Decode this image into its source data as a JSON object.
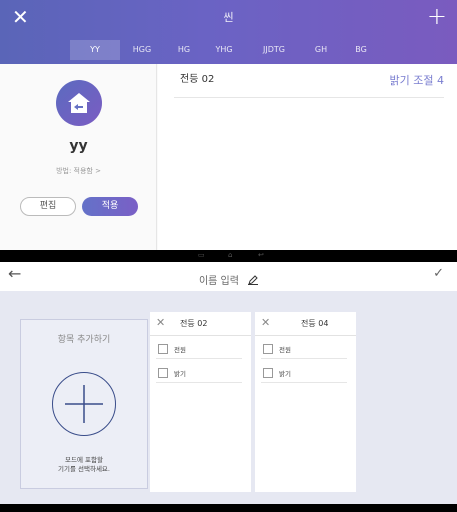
{
  "top": {
    "close_icon": "close-icon",
    "title": "씬",
    "add_icon": "plus-icon",
    "tabs": [
      "YY",
      "HGG",
      "HG",
      "YHG",
      "JJDTG",
      "GH",
      "BG"
    ],
    "mode": {
      "name": "yy",
      "sub": "방법: 적용함 >",
      "edit_label": "편집",
      "apply_label": "적용"
    },
    "device": {
      "name": "전등 02",
      "value": "밝기 조절 4"
    }
  },
  "bottom": {
    "back_icon": "arrow-left-icon",
    "name_placeholder": "이름 입력",
    "confirm_icon": "check-icon",
    "add_card": {
      "title": "항목 추가하기",
      "desc_line1": "모드에 포함할",
      "desc_line2": "기기를 선택하세요."
    },
    "groups": [
      {
        "title": "전등 02",
        "options": [
          "전원",
          "밝기"
        ]
      },
      {
        "title": "전등 04",
        "options": [
          "전원",
          "밝기"
        ]
      }
    ]
  },
  "colors": {
    "header_gradient_start": "#5a65b8",
    "header_gradient_end": "#7a5bbf",
    "accent": "#7a7ed0",
    "add_circle": "#3a4d8a"
  }
}
